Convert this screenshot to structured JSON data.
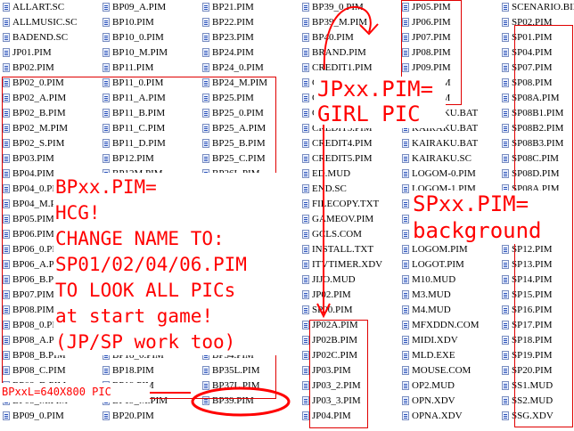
{
  "file_list": {
    "columns": [
      [
        "ALLART.SC",
        "ALLMUSIC.SC",
        "BADEND.SC",
        "JP01.PIM",
        "BP02.PIM",
        "BP02_0.PIM",
        "BP02_A.PIM",
        "BP02_B.PIM",
        "BP02_M.PIM",
        "BP02_S.PIM",
        "BP03.PIM",
        "BP04.PIM",
        "BP04_0.PIM",
        "BP04_M.PIM",
        "BP05.PIM",
        "BP06.PIM",
        "BP06_0.PIM",
        "BP06_A.PIM",
        "BP06_B.PIM",
        "BP07.PIM",
        "BP08.PIM",
        "BP08_0.PIM",
        "BP08_A.PIM",
        "BP08_B.PIM",
        "BP08_C.PIM",
        "BP08_D.PIM",
        "BP08_M.PIM",
        "BP09_0.PIM"
      ],
      [
        "BP09_A.PIM",
        "BP10.PIM",
        "BP10_0.PIM",
        "BP10_M.PIM",
        "BP11.PIM",
        "BP11_0.PIM",
        "BP11_A.PIM",
        "BP11_B.PIM",
        "BP11_C.PIM",
        "BP11_D.PIM",
        "BP12.PIM",
        "BP12M.PIM",
        "BP13.PIM",
        "BP13_M.PIM",
        "BP14.PIM",
        "BP14_0.PIM",
        "BP15.PIM",
        "BP15_0.PIM",
        "BP15_M.PIM",
        "BP16.PIM",
        "BP17.PIM",
        "BP17_0.PIM",
        "BP17_M.PIM",
        "BP18_0.PIM",
        "BP18.PIM",
        "BP19.PIM",
        "BP19_M.PIM",
        "BP20.PIM"
      ],
      [
        "BP21.PIM",
        "BP22.PIM",
        "BP23.PIM",
        "BP24.PIM",
        "BP24_0.PIM",
        "BP24_M.PIM",
        "BP25.PIM",
        "BP25_0.PIM",
        "BP25_A.PIM",
        "BP25_B.PIM",
        "BP25_C.PIM",
        "BP26L.PIM",
        "BP27.PIM",
        "BP27_0.PIM",
        "BP28.PIM",
        "BP28_M.PIM",
        "BP29.PIM",
        "BP29_0.PIM",
        "BP30.PIM",
        "BP30_0.PIM",
        "BP31.PIM",
        "BP32.PIM",
        "BP33.PIM",
        "BP34.PIM",
        "BP35L.PIM",
        "BP37L.PIM",
        "BP39.PIM"
      ],
      [
        "BP39_0.PIM",
        "BP39_M.PIM",
        "BP40.PIM",
        "BRAND.PIM",
        "CREDIT1.PIM",
        "CREDIT1.PIM",
        "CREDIT2.PIM",
        "CREDIT2.PIM",
        "CREDIT3.PIM",
        "CREDIT4.PIM",
        "CREDIT5.PIM",
        "ED.MUD",
        "END.SC",
        "FILECOPY.TXT",
        "GAMEOV.PIM",
        "GCLS.COM",
        "INSTALL.TXT",
        "ITVTIMER.XDV",
        "JIJO.MUD",
        "JP02.PIM",
        "SP00.PIM",
        "JP02A.PIM",
        "JP02B.PIM",
        "JP02C.PIM",
        "JP03.PIM",
        "JP03_2.PIM",
        "JP03_3.PIM",
        "JP04.PIM"
      ],
      [
        "JP05.PIM",
        "JP06.PIM",
        "JP07.PIM",
        "JP08.PIM",
        "JP09.PIM",
        "JP10.PIM",
        "JP11.PIM",
        "KAIRAKU.BAT",
        "KAIRAKU.BAT",
        "KAIRAKU.BAT",
        "KAIRAKU.SC",
        "LOGOM-0.PIM",
        "LOGOM-1.PIM",
        "LOGOM-2.PIM",
        "LOGOM-3.PIM",
        "LOGOM-4.PIM",
        "LOGOM.PIM",
        "LOGOT.PIM",
        "M10.MUD",
        "M3.MUD",
        "M4.MUD",
        "MFXDDN.COM",
        "MIDI.XDV",
        "MLD.EXE",
        "MOUSE.COM",
        "OP2.MUD",
        "OPN.XDV",
        "OPNA.XDV"
      ],
      [
        "SCENARIO.BIN",
        "SP02.PIM",
        "SP01.PIM",
        "SP04.PIM",
        "SP07.PIM",
        "SP08.PIM",
        "SP08A.PIM",
        "SP08B1.PIM",
        "SP08B2.PIM",
        "SP08B3.PIM",
        "SP08C.PIM",
        "SP08D.PIM",
        "SP08A.PIM",
        "SP09.PIM",
        "SP10.PIM",
        "SP11.PIM",
        "SP12.PIM",
        "SP13.PIM",
        "SP14.PIM",
        "SP15.PIM",
        "SP16.PIM",
        "SP17.PIM",
        "SP18.PIM",
        "SP19.PIM",
        "SP20.PIM",
        "SS1.MUD",
        "SS2.MUD",
        "SSG.XDV"
      ]
    ]
  },
  "annotations": {
    "jp_note": "JPxx.PIM=\nGIRL PIC",
    "sp_note": "SPxx.PIM=\nbackground",
    "bp_note": "BPxx.PIM=\nHCG!\nCHANGE NAME TO:\nSP01/02/04/06.PIM\nTO LOOK ALL PICs\nat start game!\n(JP/SP work too)",
    "bpxxl_note": "BPxxL=640X800 PIC",
    "ink_color": "#ff0000"
  }
}
